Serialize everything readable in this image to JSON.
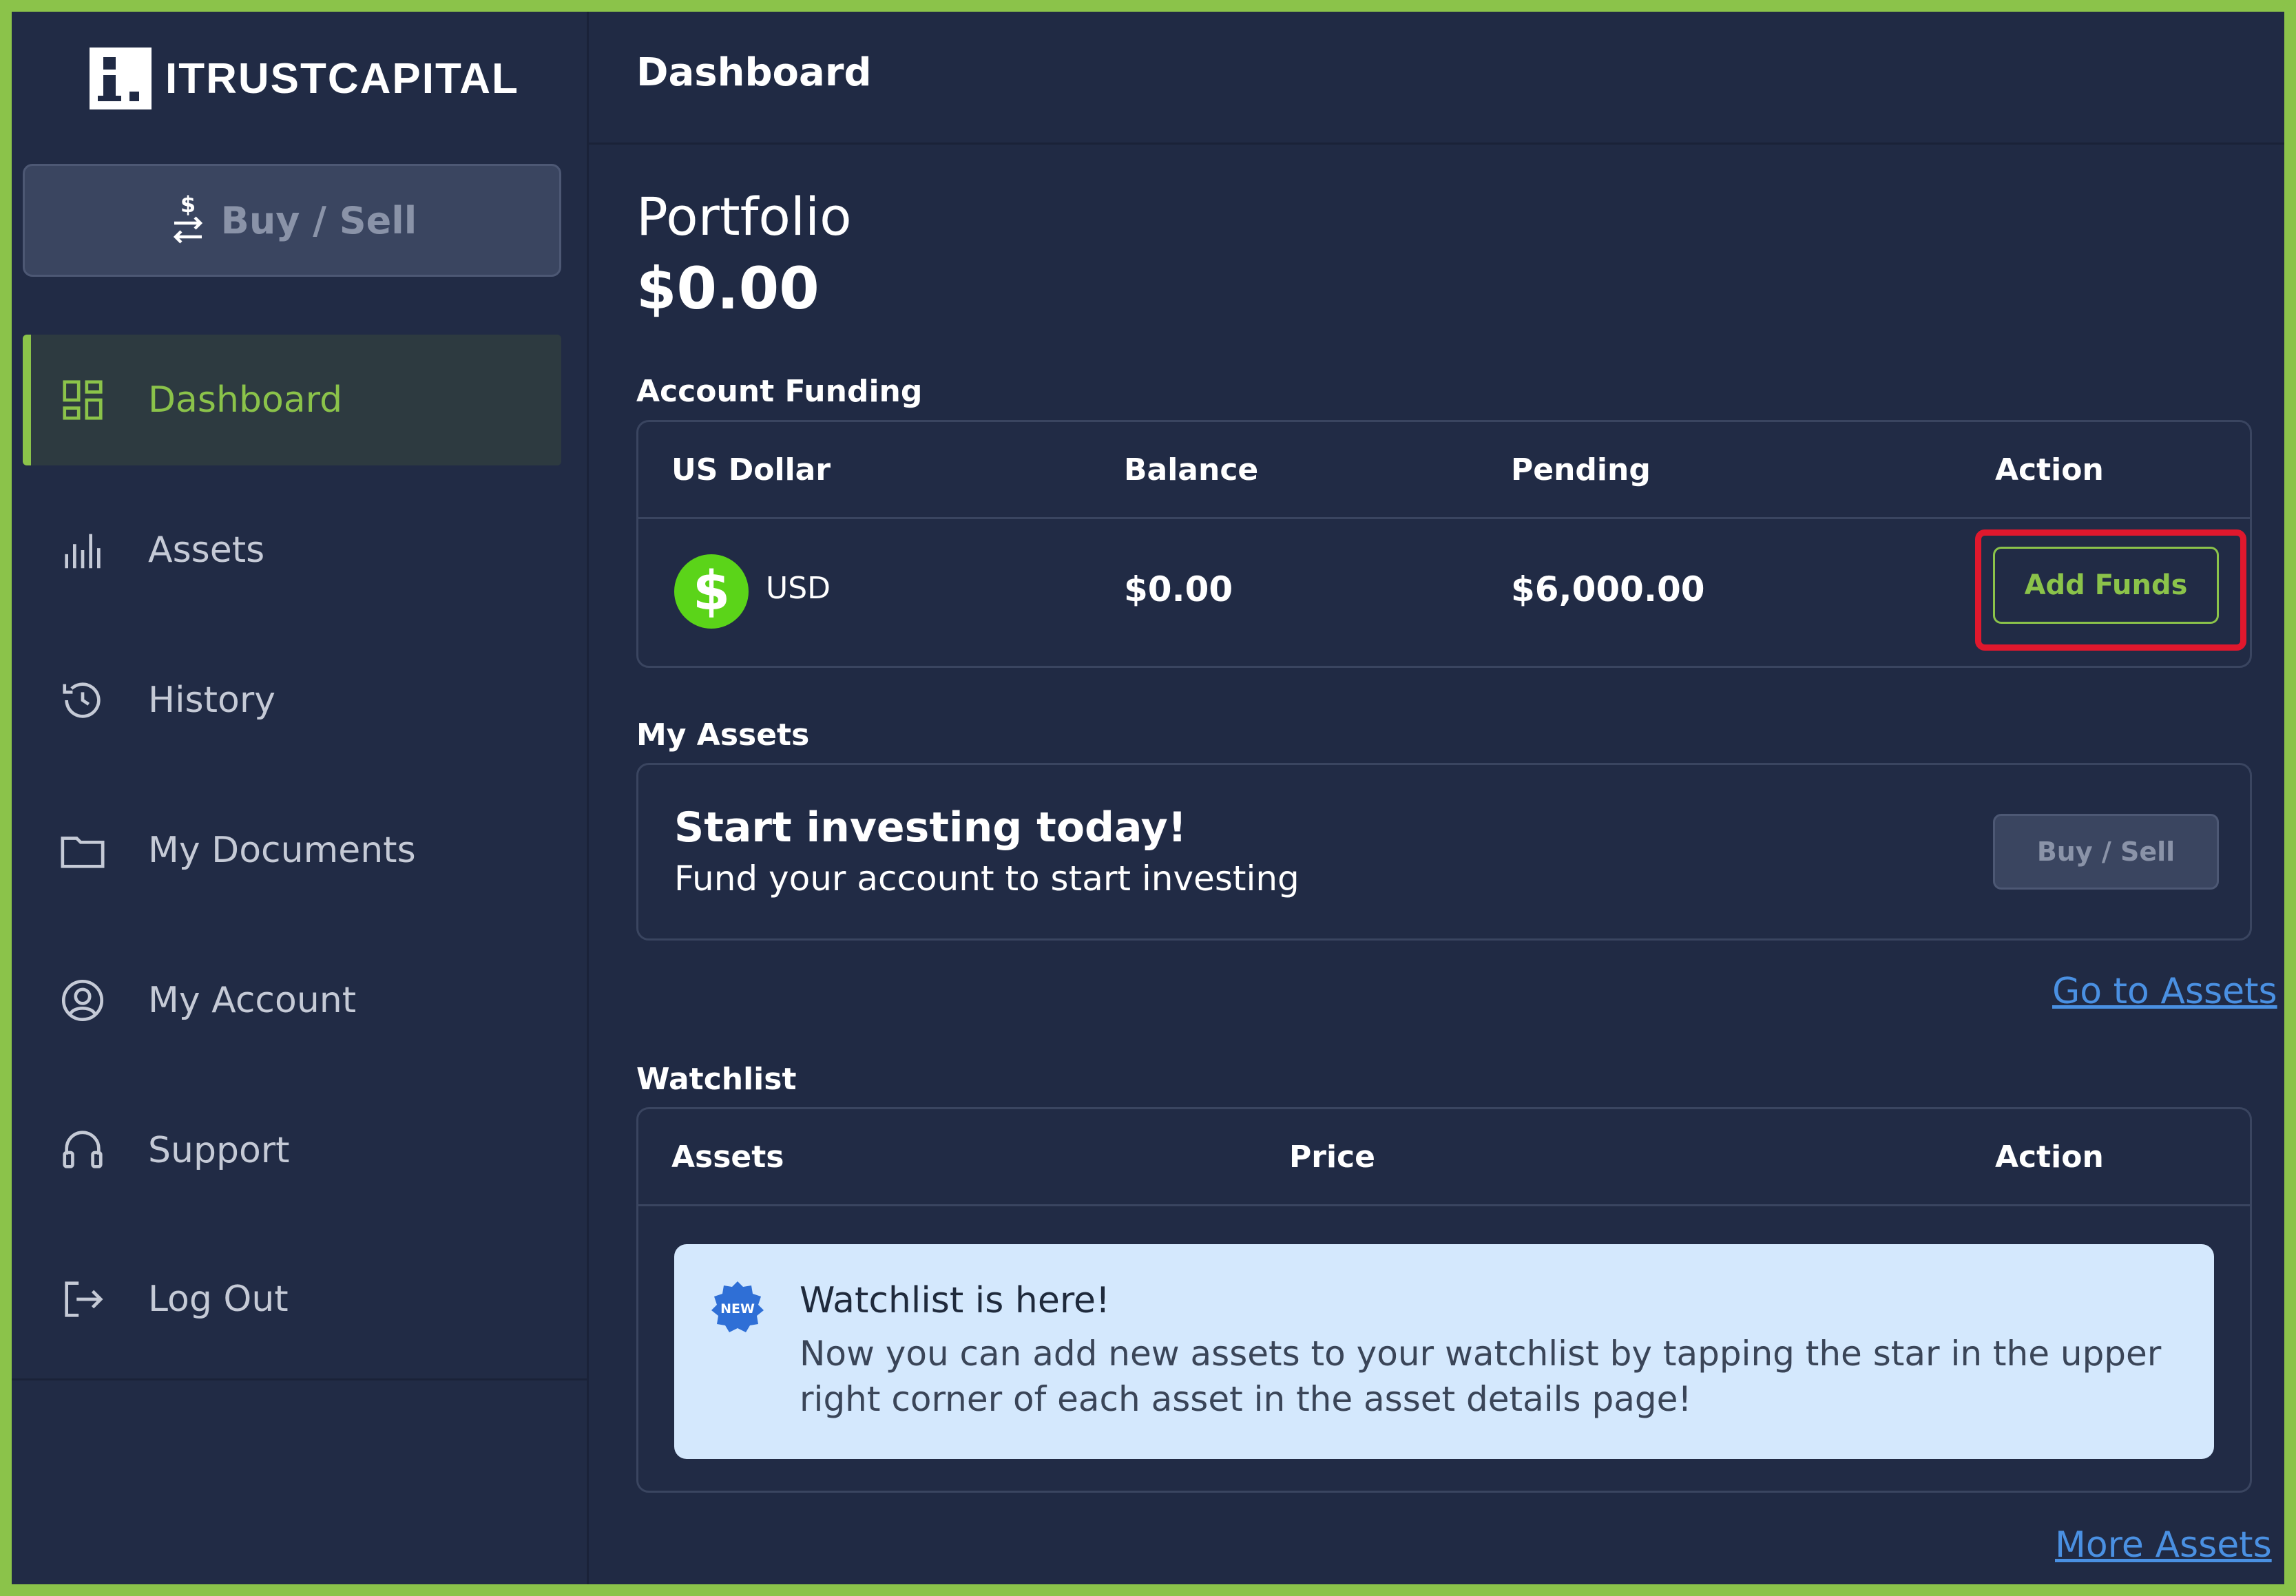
{
  "app": {
    "logo_text": "ITRUSTCAPITAL"
  },
  "sidebar": {
    "buy_sell_label": "Buy / Sell",
    "items": [
      {
        "label": "Dashboard",
        "icon": "dashboard-icon",
        "active": true
      },
      {
        "label": "Assets",
        "icon": "bar-chart-icon"
      },
      {
        "label": "History",
        "icon": "history-icon"
      },
      {
        "label": "My Documents",
        "icon": "folder-icon"
      },
      {
        "label": "My Account",
        "icon": "user-circle-icon"
      },
      {
        "label": "Support",
        "icon": "headset-icon"
      },
      {
        "label": "Log Out",
        "icon": "logout-icon"
      }
    ]
  },
  "header": {
    "title": "Dashboard"
  },
  "portfolio": {
    "label": "Portfolio",
    "value": "$0.00"
  },
  "account_funding": {
    "title": "Account Funding",
    "columns": [
      "US Dollar",
      "Balance",
      "Pending",
      "Action"
    ],
    "row": {
      "currency_symbol": "$",
      "currency": "USD",
      "balance": "$0.00",
      "pending": "$6,000.00",
      "action_label": "Add Funds"
    }
  },
  "my_assets": {
    "title": "My Assets",
    "headline": "Start investing today!",
    "subtext": "Fund your account to start investing",
    "button_label": "Buy / Sell",
    "link": "Go to Assets"
  },
  "watchlist": {
    "title": "Watchlist",
    "columns": [
      "Assets",
      "Price",
      "Action"
    ],
    "notice": {
      "badge": "NEW",
      "title": "Watchlist is here!",
      "body": "Now you can add new assets to your watchlist by tapping the star in the upper right corner of each asset in the asset details page!"
    },
    "link": "More Assets"
  },
  "colors": {
    "accent": "#8bc34a",
    "background": "#202a44",
    "link": "#4a90e2",
    "highlight": "#e0182d",
    "usd_coin": "#5bd419"
  }
}
